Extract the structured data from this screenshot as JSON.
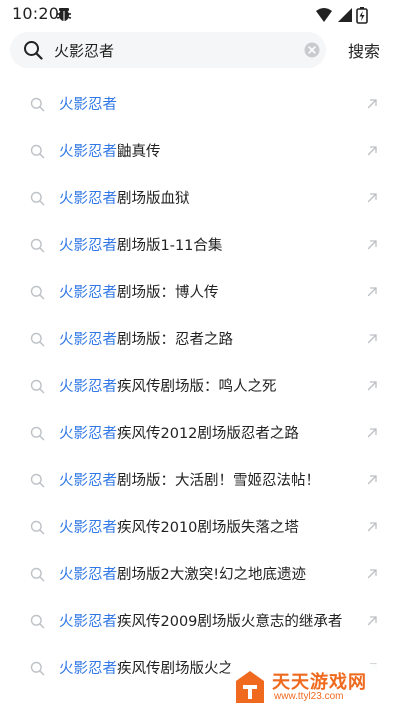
{
  "status_bar": {
    "time": "10:20",
    "icons": [
      "bug-icon",
      "wifi-icon",
      "signal-icon",
      "battery-icon"
    ]
  },
  "search": {
    "query": "火影忍者",
    "clear_icon": "clear-icon",
    "button_label": "搜索"
  },
  "colors": {
    "highlight": "#3178e6",
    "text": "#222222",
    "watermark": "#ef6a1f"
  },
  "suggestions": [
    {
      "highlight": "火影忍者",
      "rest": ""
    },
    {
      "highlight": "火影忍者",
      "rest": "鼬真传"
    },
    {
      "highlight": "火影忍者",
      "rest": "剧场版血狱"
    },
    {
      "highlight": "火影忍者",
      "rest": "剧场版1-11合集"
    },
    {
      "highlight": "火影忍者",
      "rest": "剧场版：博人传"
    },
    {
      "highlight": "火影忍者",
      "rest": "剧场版：忍者之路"
    },
    {
      "highlight": "火影忍者",
      "rest": "疾风传剧场版：鸣人之死"
    },
    {
      "highlight": "火影忍者",
      "rest": "疾风传2012剧场版忍者之路"
    },
    {
      "highlight": "火影忍者",
      "rest": "剧场版：大活剧！雪姬忍法帖！"
    },
    {
      "highlight": "火影忍者",
      "rest": "疾风传2010剧场版失落之塔"
    },
    {
      "highlight": "火影忍者",
      "rest": "剧场版2大激突!幻之地底遗迹"
    },
    {
      "highlight": "火影忍者",
      "rest": "疾风传2009剧场版火意志的继承者"
    },
    {
      "highlight": "火影忍者",
      "rest": "疾风传剧场版火之"
    }
  ],
  "watermark": {
    "title": "天天游戏网",
    "url": "www.ttyl23.com"
  }
}
